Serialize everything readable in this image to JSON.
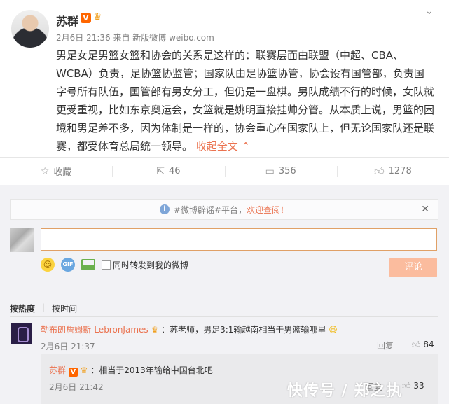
{
  "post": {
    "author": "苏群",
    "verified_badge": "V",
    "meta": "2月6日 21:36 来自 新版微博 weibo.com",
    "content": "男足女足男篮女篮和协会的关系是这样的：联赛层面由联盟（中超、CBA、WCBA）负责，足协篮协监管；国家队由足协篮协管，协会设有国管部，负责国字号所有队伍，国管部有男女分工，但仍是一盘棋。男队成绩不行的时候，女队就更受重视，比如东京奥运会，女篮就是姚明直接挂帅分管。从本质上说，男篮的困境和男足差不多，因为体制是一样的，协会重心在国家队上，但无论国家队还是联赛，都受体育总局统一领导。",
    "collapse_label": "收起全文",
    "collapse_icon": "chevron-up-icon",
    "more_icon": "chevron-down-icon"
  },
  "actions": {
    "favorite_label": "收藏",
    "repost_count": "46",
    "comment_count": "356",
    "like_count": "1278"
  },
  "comment_area": {
    "notice_topic": "#微博辟谣#平台，",
    "notice_link": "欢迎查阅！",
    "input_value": "",
    "repost_checkbox_label": "同时转发到我的微博",
    "submit_label": "评论"
  },
  "sort": {
    "by_heat": "按热度",
    "by_time": "按时间"
  },
  "comments": [
    {
      "user": "勒布朗詹姆斯-LebronJames",
      "text": "：苏老师，男足3:1输越南相当于男篮输哪里",
      "time": "2月6日 21:37",
      "reply_label": "回复",
      "likes": "84"
    }
  ],
  "sub_reply": {
    "user": "苏群",
    "badge": "V",
    "text": "：相当于2013年输给中国台北吧",
    "time": "2月6日 21:42",
    "reply_label": "回复",
    "likes": "33"
  },
  "watermark": "快传号 / 郑之执",
  "colors": {
    "accent": "#eb7350",
    "submit_disabled": "#fbbc9e",
    "verified": "#ff6600"
  }
}
